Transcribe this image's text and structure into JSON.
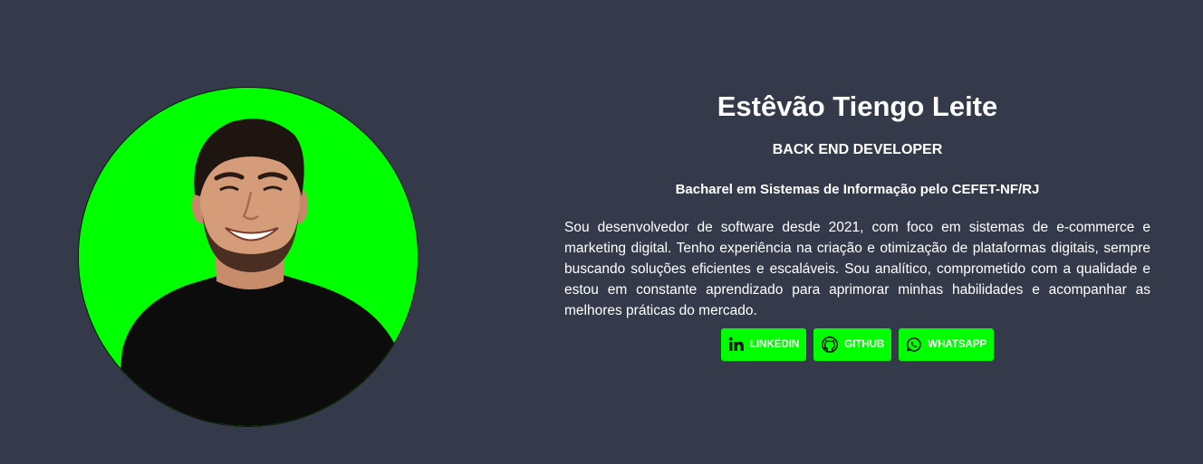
{
  "profile": {
    "name": "Estêvão Tiengo Leite",
    "role": "BACK END DEVELOPER",
    "degree": "Bacharel em Sistemas de Informação pelo CEFET-NF/RJ",
    "bio": "Sou desenvolvedor de software desde 2021, com foco em sistemas de e-commerce e marketing digital. Tenho experiência na criação e otimização de plataformas digitais, sempre buscando soluções eficientes e escaláveis. Sou analítico, comprometido com a qualidade e estou em constante aprendizado para aprimorar minhas habilidades e acompanhar as melhores práticas do mercado."
  },
  "buttons": [
    {
      "label": "LINKEDIN",
      "icon": "linkedin-icon"
    },
    {
      "label": "GITHUB",
      "icon": "github-icon"
    },
    {
      "label": "WHATSAPP",
      "icon": "whatsapp-icon"
    }
  ],
  "colors": {
    "background": "#343a4a",
    "accent": "#00ff00",
    "text": "#ffffff"
  }
}
